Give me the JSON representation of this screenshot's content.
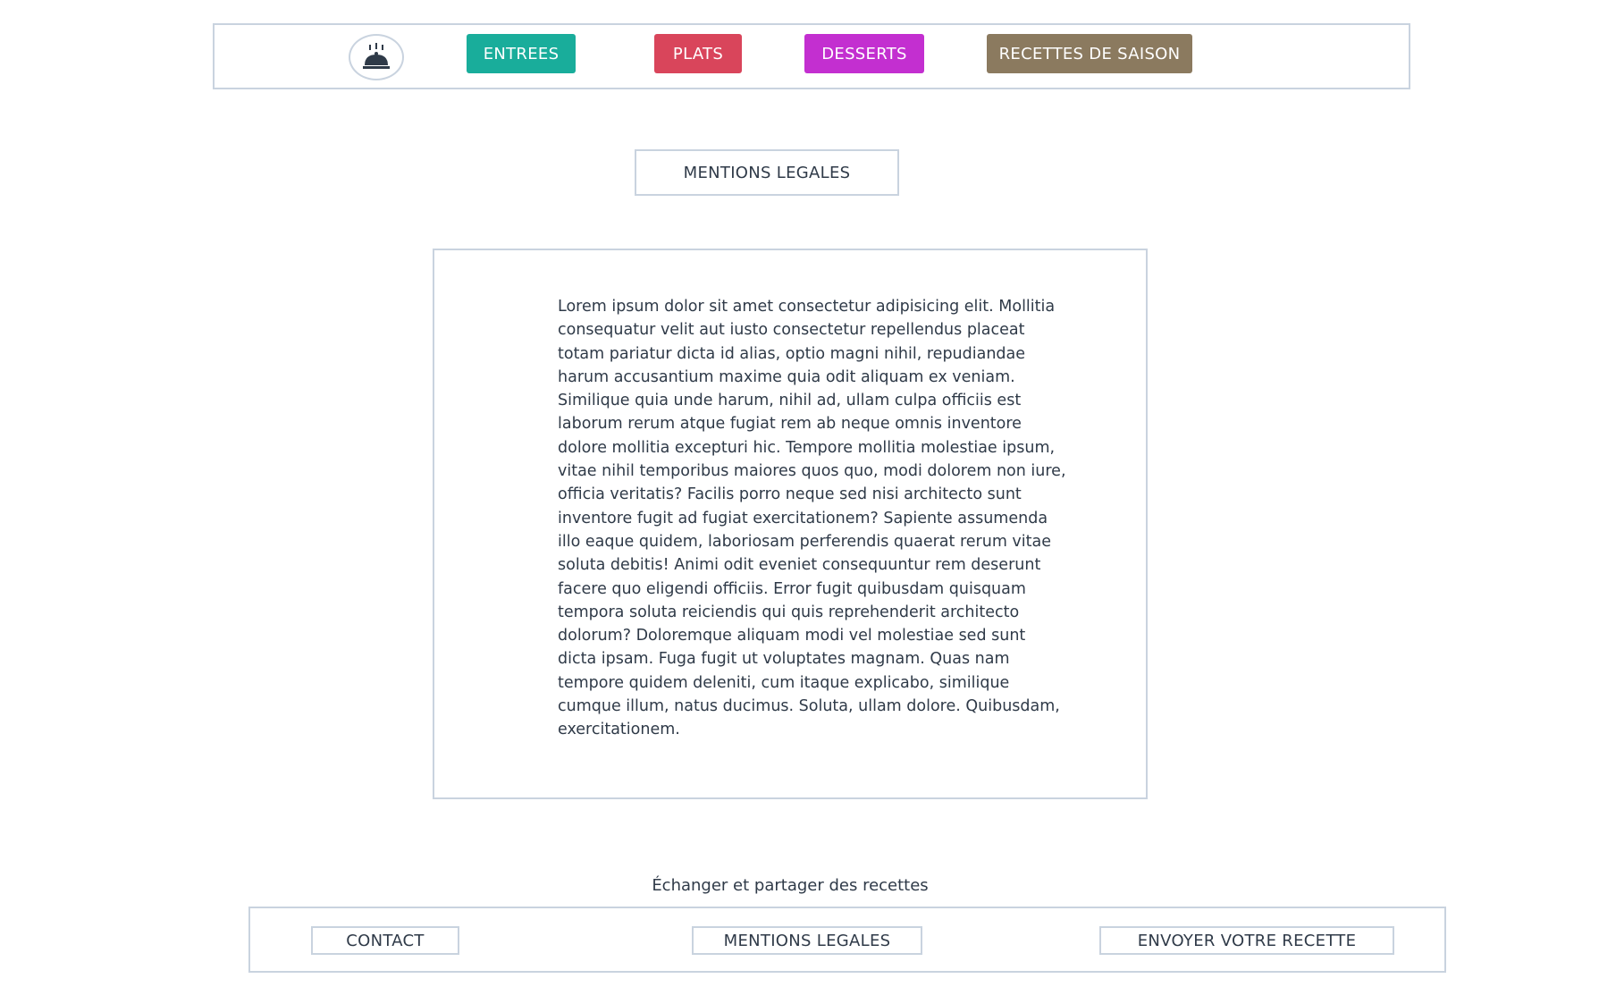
{
  "header": {
    "logo_icon": "cloche-icon",
    "nav": [
      {
        "label": "ENTREES",
        "color": "#19ad9b"
      },
      {
        "label": "PLATS",
        "color": "#d9455b"
      },
      {
        "label": "DESSERTS",
        "color": "#c32fd0"
      },
      {
        "label": "RECETTES DE SAISON",
        "color": "#8b7a5f"
      }
    ]
  },
  "page": {
    "title": "MENTIONS LEGALES",
    "body": "Lorem ipsum dolor sit amet consectetur adipisicing elit. Mollitia consequatur velit aut iusto consectetur repellendus placeat totam pariatur dicta id alias, optio magni nihil, repudiandae harum accusantium maxime quia odit aliquam ex veniam. Similique quia unde harum, nihil ad, ullam culpa officiis est laborum rerum atque fugiat rem ab neque omnis inventore dolore mollitia excepturi hic. Tempore mollitia molestiae ipsum, vitae nihil temporibus maiores quos quo, modi dolorem non iure, officia veritatis? Facilis porro neque sed nisi architecto sunt inventore fugit ad fugiat exercitationem? Sapiente assumenda illo eaque quidem, laboriosam perferendis quaerat rerum vitae soluta debitis! Animi odit eveniet consequuntur rem deserunt facere quo eligendi officiis. Error fugit quibusdam quisquam tempora soluta reiciendis qui quis reprehenderit architecto dolorum? Doloremque aliquam modi vel molestiae sed sunt dicta ipsam. Fuga fugit ut voluptates magnam. Quas nam tempore quidem deleniti, cum itaque explicabo, similique cumque illum, natus ducimus. Soluta, ullam dolore. Quibusdam, exercitationem."
  },
  "footer": {
    "tagline": "Échanger et partager des recettes",
    "links": [
      {
        "label": "CONTACT"
      },
      {
        "label": "MENTIONS LEGALES"
      },
      {
        "label": "ENVOYER VOTRE RECETTE"
      }
    ]
  },
  "colors": {
    "border": "#c9d3df",
    "text": "#2f3a48"
  }
}
